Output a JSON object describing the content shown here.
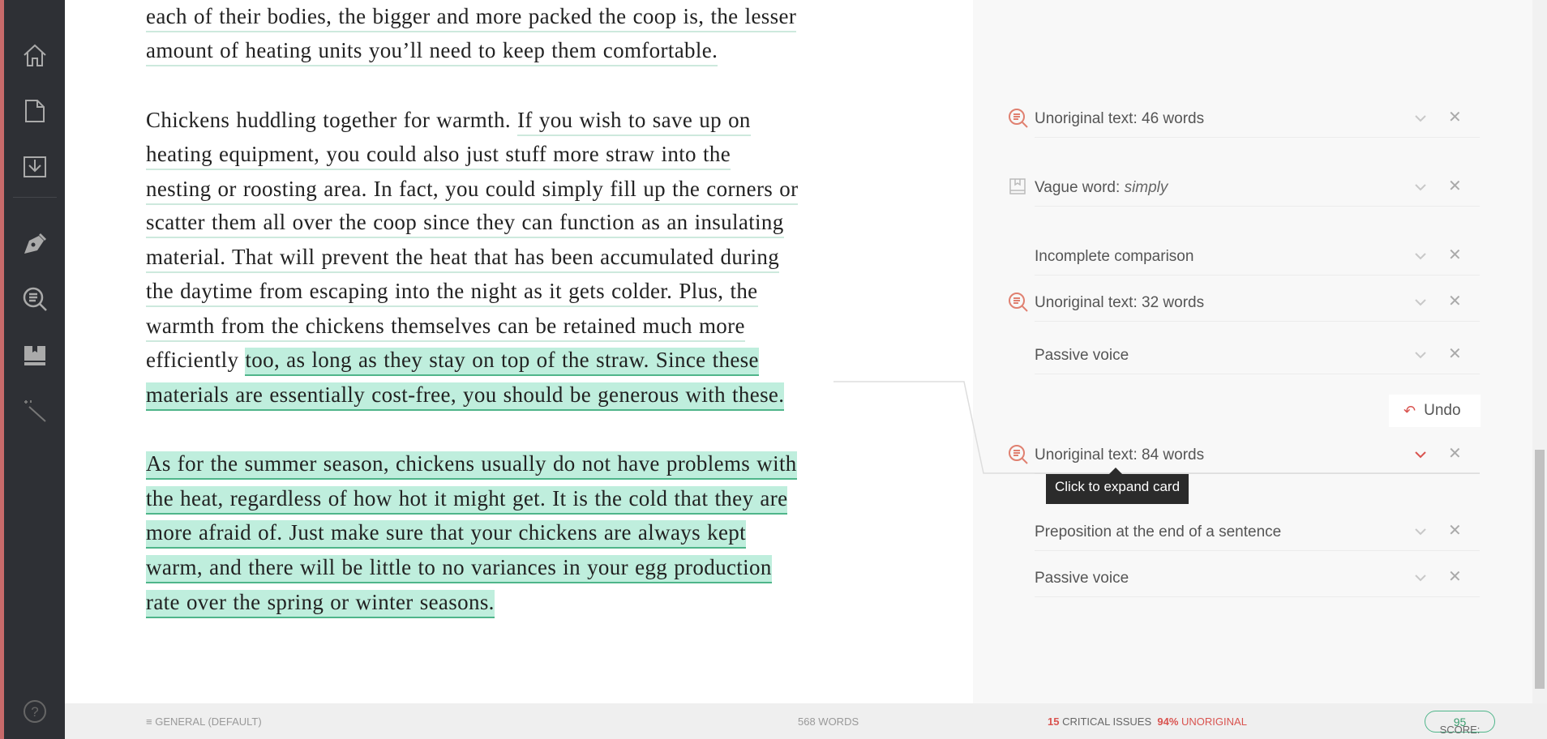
{
  "sidebar": {
    "icons": [
      "home-icon",
      "document-icon",
      "download-icon",
      "pen-icon",
      "search-text-icon",
      "book-icon",
      "magic-wand-icon",
      "help-icon"
    ]
  },
  "editor": {
    "paragraphs": [
      {
        "lines": [
          [
            {
              "t": "each of their bodies, the bigger and more packed the coop is, the lesser",
              "s": "u"
            }
          ],
          [
            {
              "t": "amount of heating units you’ll need to keep them comfortable.",
              "s": "u"
            }
          ]
        ]
      },
      {
        "lines": [
          [
            {
              "t": "Chickens huddling together for warmth. ",
              "s": ""
            },
            {
              "t": "If you wish to save up on",
              "s": "u"
            }
          ],
          [
            {
              "t": "heating equipment, you could also just stuff more straw into the",
              "s": "u"
            }
          ],
          [
            {
              "t": "nesting or roosting area. In fact, you could simply fill up the corners or",
              "s": "u"
            }
          ],
          [
            {
              "t": "scatter them all over the coop since they can function as an insulating",
              "s": "u"
            }
          ],
          [
            {
              "t": "material. ",
              "s": "u"
            },
            {
              "t": "That will prevent the heat that has been accumulated during",
              "s": "u"
            }
          ],
          [
            {
              "t": "the daytime from escaping into the night as it gets colder. Plus, the",
              "s": "u"
            }
          ],
          [
            {
              "t": "warmth from the chickens themselves can be retained much more",
              "s": "u"
            }
          ],
          [
            {
              "t": "efficiently ",
              "s": ""
            },
            {
              "t": "too, as long as they stay on top of the straw. Since these",
              "s": "h"
            }
          ],
          [
            {
              "t": "materials are essentially cost-free, you should be generous with these.",
              "s": "h"
            }
          ]
        ]
      },
      {
        "lines": [
          [
            {
              "t": "As for the summer season, chickens usually do not have problems with",
              "s": "h"
            }
          ],
          [
            {
              "t": "the heat, regardless of how hot it might get. It is the cold that they are",
              "s": "h"
            }
          ],
          [
            {
              "t": "more afraid of. Just make sure that your chickens are always kept",
              "s": "h"
            }
          ],
          [
            {
              "t": "warm, and there will be little to no variances in your egg production",
              "s": "h"
            }
          ],
          [
            {
              "t": "rate over the spring or winter seasons.",
              "s": "h"
            }
          ]
        ]
      }
    ]
  },
  "panel": {
    "cards": [
      {
        "title": "Unoriginal text: 46 words",
        "icon": "plagiarism-icon"
      },
      {
        "title": "Vague word: ",
        "italic": "simply",
        "icon": "book-icon"
      },
      {
        "title": "Incomplete comparison",
        "icon": ""
      },
      {
        "title": "Unoriginal text: 32 words",
        "icon": "plagiarism-icon"
      },
      {
        "title": "Passive voice",
        "icon": ""
      },
      {
        "title": "Unoriginal text: 84 words",
        "icon": "plagiarism-icon",
        "active": true
      },
      {
        "title": "Preposition at the end of a sentence",
        "icon": ""
      },
      {
        "title": "Passive voice",
        "icon": ""
      }
    ],
    "undo_label": "Undo",
    "tooltip": "Click to expand card"
  },
  "footer": {
    "style": "GENERAL (DEFAULT)",
    "words": "568 WORDS",
    "critical_count": "15",
    "critical_label": "CRITICAL ISSUES",
    "unoriginal_pct": "94%",
    "unoriginal_label": "UNORIGINAL",
    "score_label": "SCORE:",
    "score_value": "95"
  },
  "colors": {
    "sidebar": "#2e3035",
    "highlight": "#bfeedd",
    "accent_red": "#d9534f",
    "score_green": "#3a9d6e"
  }
}
